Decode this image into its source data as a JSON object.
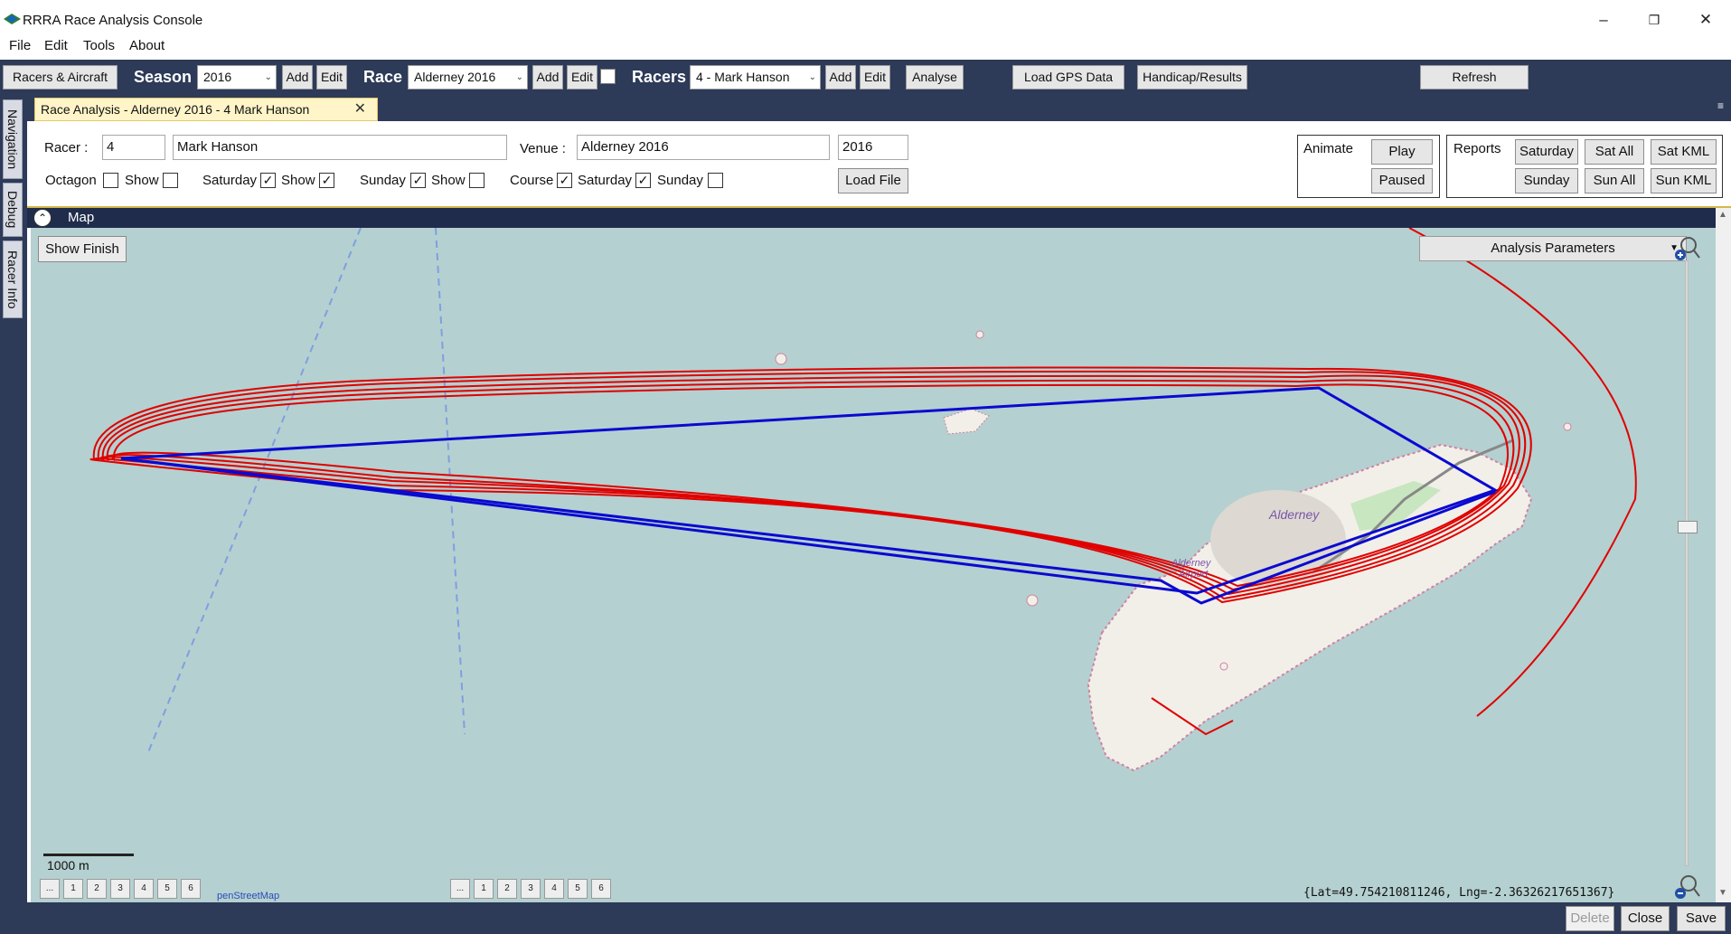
{
  "window": {
    "title": "RRRA Race Analysis Console",
    "minimize": "–",
    "restore": "❐",
    "close": "✕"
  },
  "menu": [
    "File",
    "Edit",
    "Tools",
    "About"
  ],
  "toolbar": {
    "racers_aircraft": "Racers & Aircraft",
    "season_label": "Season",
    "season_value": "2016",
    "race_label": "Race",
    "race_value": "Alderney 2016",
    "racers_label": "Racers",
    "racers_value": "4 - Mark Hanson",
    "add": "Add",
    "edit": "Edit",
    "analyse": "Analyse",
    "load_gps": "Load GPS Data",
    "handicap": "Handicap/Results",
    "refresh": "Refresh"
  },
  "side_tabs": [
    "Navigation",
    "Debug",
    "Racer Info"
  ],
  "doc_tab": {
    "label": "Race Analysis - Alderney 2016 - 4 Mark Hanson",
    "close": "✕"
  },
  "form": {
    "racer_label": "Racer :",
    "racer_id": "4",
    "racer_name": "Mark Hanson",
    "venue_label": "Venue :",
    "venue_value": "Alderney 2016",
    "year": "2016",
    "octagon_label": "Octagon",
    "show_label": "Show",
    "saturday_label": "Saturday",
    "sunday_label": "Sunday",
    "course_label": "Course",
    "check_mark": "✓",
    "load_file": "Load File",
    "animate_label": "Animate",
    "play": "Play",
    "paused": "Paused",
    "reports_label": "Reports",
    "r_saturday": "Saturday",
    "r_sunday": "Sunday",
    "sat_all": "Sat All",
    "sun_all": "Sun All",
    "sat_kml": "Sat KML",
    "sun_kml": "Sun KML"
  },
  "map": {
    "header": "Map",
    "show_finish": "Show Finish",
    "analysis_params": "Analysis Parameters",
    "scale": "1000 m",
    "place_alderney": "Alderney",
    "place_airport_1": "Alderney",
    "place_airport_2": "Airport",
    "credit": "penStreetMap",
    "page_buttons": [
      "...",
      "1",
      "2",
      "3",
      "4",
      "5",
      "6"
    ],
    "coordinates": "{Lat=49.754210811246, Lng=-2.36326217651367}",
    "colors": {
      "sea": "#b5d0d0",
      "land": "#f2efe9",
      "track": "#e00000",
      "course": "#0a0ad0"
    }
  },
  "bottom": {
    "delete": "Delete",
    "close": "Close",
    "save": "Save"
  }
}
